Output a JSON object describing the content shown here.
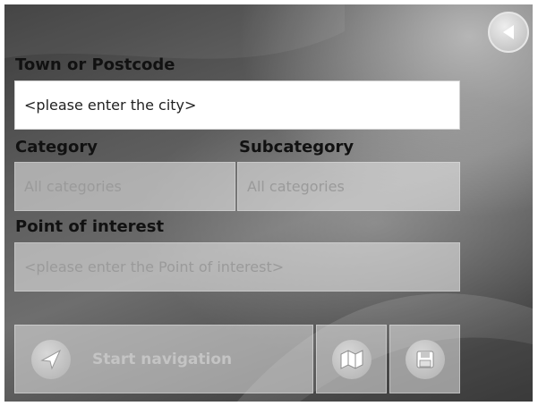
{
  "form": {
    "town_label": "Town or Postcode",
    "town_placeholder": "<please enter the city>",
    "category_label": "Category",
    "category_value": "All categories",
    "subcategory_label": "Subcategory",
    "subcategory_value": "All categories",
    "poi_label": "Point of interest",
    "poi_placeholder": "<please enter the Point of interest>"
  },
  "buttons": {
    "start_navigation": "Start navigation",
    "back_icon": "back-arrow-icon",
    "map_icon": "map-icon",
    "save_icon": "save-icon",
    "navigate_icon": "navigation-arrow-icon"
  },
  "colors": {
    "field_active": "#ffffff",
    "field_disabled": "#e1e1e1",
    "label_text": "#111111"
  }
}
